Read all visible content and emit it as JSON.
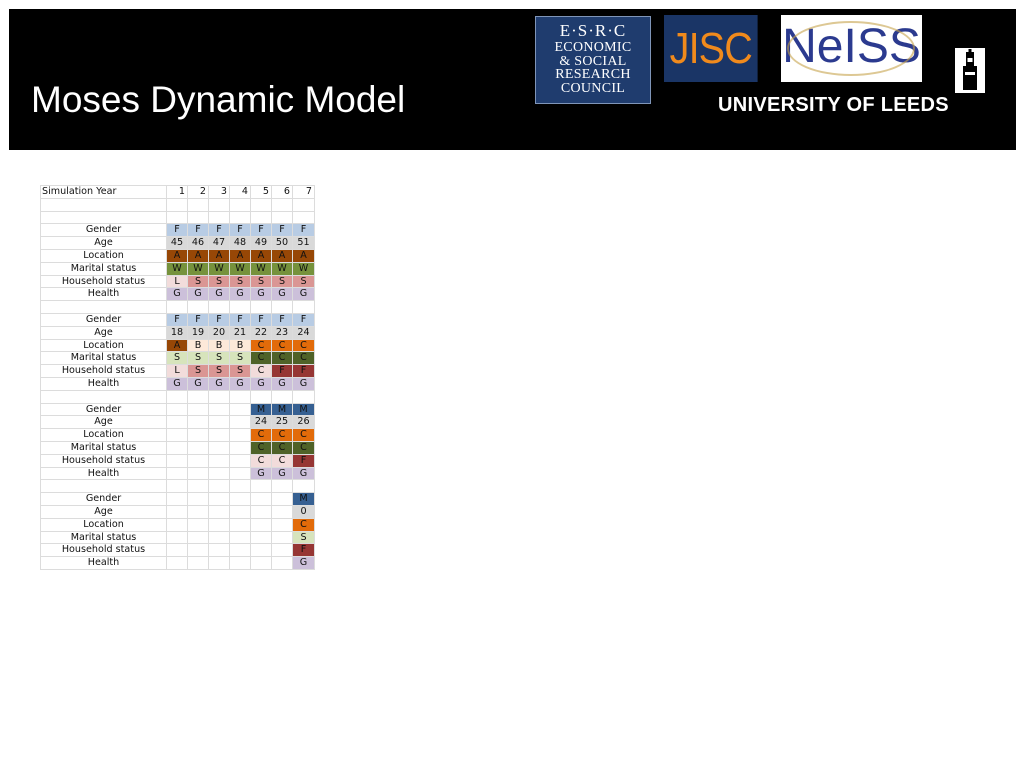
{
  "header": {
    "title": "Moses Dynamic Model",
    "logos": {
      "esrc": [
        "E·S·R·C",
        "ECONOMIC",
        "& SOCIAL",
        "RESEARCH",
        "COUNCIL"
      ],
      "jisc": "JISC",
      "neiss": "NeISS",
      "leeds": "UNIVERSITY OF LEEDS"
    }
  },
  "colors": {
    "gender_f": "#b8cce4",
    "gender_m": "#366092",
    "age": "#d9d9d9",
    "loc_a": "#974706",
    "loc_b": "#fde9d9",
    "loc_c": "#e26b0a",
    "marital_w": "#76923c",
    "marital_s": "#d7e4bc",
    "marital_c": "#4f6228",
    "household_l": "#f2dcdb",
    "household_s": "#da9694",
    "household_c": "#f2dcdb",
    "household_f": "#963634",
    "health_g": "#ccc0da"
  },
  "table": {
    "header_label": "Simulation Year",
    "years": [
      "1",
      "2",
      "3",
      "4",
      "5",
      "6",
      "7"
    ],
    "persons": [
      {
        "rows": [
          {
            "label": "Gender",
            "values": [
              "F",
              "F",
              "F",
              "F",
              "F",
              "F",
              "F"
            ],
            "colors": [
              "gender_f",
              "gender_f",
              "gender_f",
              "gender_f",
              "gender_f",
              "gender_f",
              "gender_f"
            ]
          },
          {
            "label": "Age",
            "values": [
              "45",
              "46",
              "47",
              "48",
              "49",
              "50",
              "51"
            ],
            "colors": [
              "age",
              "age",
              "age",
              "age",
              "age",
              "age",
              "age"
            ]
          },
          {
            "label": "Location",
            "values": [
              "A",
              "A",
              "A",
              "A",
              "A",
              "A",
              "A"
            ],
            "colors": [
              "loc_a",
              "loc_a",
              "loc_a",
              "loc_a",
              "loc_a",
              "loc_a",
              "loc_a"
            ]
          },
          {
            "label": "Marital status",
            "values": [
              "W",
              "W",
              "W",
              "W",
              "W",
              "W",
              "W"
            ],
            "colors": [
              "marital_w",
              "marital_w",
              "marital_w",
              "marital_w",
              "marital_w",
              "marital_w",
              "marital_w"
            ]
          },
          {
            "label": "Household status",
            "values": [
              "L",
              "S",
              "S",
              "S",
              "S",
              "S",
              "S"
            ],
            "colors": [
              "household_l",
              "household_s",
              "household_s",
              "household_s",
              "household_s",
              "household_s",
              "household_s"
            ]
          },
          {
            "label": "Health",
            "values": [
              "G",
              "G",
              "G",
              "G",
              "G",
              "G",
              "G"
            ],
            "colors": [
              "health_g",
              "health_g",
              "health_g",
              "health_g",
              "health_g",
              "health_g",
              "health_g"
            ]
          }
        ]
      },
      {
        "rows": [
          {
            "label": "Gender",
            "values": [
              "F",
              "F",
              "F",
              "F",
              "F",
              "F",
              "F"
            ],
            "colors": [
              "gender_f",
              "gender_f",
              "gender_f",
              "gender_f",
              "gender_f",
              "gender_f",
              "gender_f"
            ]
          },
          {
            "label": "Age",
            "values": [
              "18",
              "19",
              "20",
              "21",
              "22",
              "23",
              "24"
            ],
            "colors": [
              "age",
              "age",
              "age",
              "age",
              "age",
              "age",
              "age"
            ]
          },
          {
            "label": "Location",
            "values": [
              "A",
              "B",
              "B",
              "B",
              "C",
              "C",
              "C"
            ],
            "colors": [
              "loc_a",
              "loc_b",
              "loc_b",
              "loc_b",
              "loc_c",
              "loc_c",
              "loc_c"
            ]
          },
          {
            "label": "Marital status",
            "values": [
              "S",
              "S",
              "S",
              "S",
              "C",
              "C",
              "C"
            ],
            "colors": [
              "marital_s",
              "marital_s",
              "marital_s",
              "marital_s",
              "marital_c",
              "marital_c",
              "marital_c"
            ]
          },
          {
            "label": "Household status",
            "values": [
              "L",
              "S",
              "S",
              "S",
              "C",
              "F",
              "F"
            ],
            "colors": [
              "household_l",
              "household_s",
              "household_s",
              "household_s",
              "household_c",
              "household_f",
              "household_f"
            ]
          },
          {
            "label": "Health",
            "values": [
              "G",
              "G",
              "G",
              "G",
              "G",
              "G",
              "G"
            ],
            "colors": [
              "health_g",
              "health_g",
              "health_g",
              "health_g",
              "health_g",
              "health_g",
              "health_g"
            ]
          }
        ]
      },
      {
        "rows": [
          {
            "label": "Gender",
            "values": [
              "",
              "",
              "",
              "",
              "M",
              "M",
              "M"
            ],
            "colors": [
              "",
              "",
              "",
              "",
              "gender_m",
              "gender_m",
              "gender_m"
            ]
          },
          {
            "label": "Age",
            "values": [
              "",
              "",
              "",
              "",
              "24",
              "25",
              "26"
            ],
            "colors": [
              "",
              "",
              "",
              "",
              "age",
              "age",
              "age"
            ]
          },
          {
            "label": "Location",
            "values": [
              "",
              "",
              "",
              "",
              "C",
              "C",
              "C"
            ],
            "colors": [
              "",
              "",
              "",
              "",
              "loc_c",
              "loc_c",
              "loc_c"
            ]
          },
          {
            "label": "Marital status",
            "values": [
              "",
              "",
              "",
              "",
              "C",
              "C",
              "C"
            ],
            "colors": [
              "",
              "",
              "",
              "",
              "marital_c",
              "marital_c",
              "marital_c"
            ]
          },
          {
            "label": "Household status",
            "values": [
              "",
              "",
              "",
              "",
              "C",
              "C",
              "F"
            ],
            "colors": [
              "",
              "",
              "",
              "",
              "household_c",
              "household_c",
              "household_f"
            ]
          },
          {
            "label": "Health",
            "values": [
              "",
              "",
              "",
              "",
              "G",
              "G",
              "G"
            ],
            "colors": [
              "",
              "",
              "",
              "",
              "health_g",
              "health_g",
              "health_g"
            ]
          }
        ]
      },
      {
        "rows": [
          {
            "label": "Gender",
            "values": [
              "",
              "",
              "",
              "",
              "",
              "",
              "M"
            ],
            "colors": [
              "",
              "",
              "",
              "",
              "",
              "",
              "gender_m"
            ]
          },
          {
            "label": "Age",
            "values": [
              "",
              "",
              "",
              "",
              "",
              "",
              "0"
            ],
            "colors": [
              "",
              "",
              "",
              "",
              "",
              "",
              "age"
            ]
          },
          {
            "label": "Location",
            "values": [
              "",
              "",
              "",
              "",
              "",
              "",
              "C"
            ],
            "colors": [
              "",
              "",
              "",
              "",
              "",
              "",
              "loc_c"
            ]
          },
          {
            "label": "Marital status",
            "values": [
              "",
              "",
              "",
              "",
              "",
              "",
              "S"
            ],
            "colors": [
              "",
              "",
              "",
              "",
              "",
              "",
              "marital_s"
            ]
          },
          {
            "label": "Household status",
            "values": [
              "",
              "",
              "",
              "",
              "",
              "",
              "F"
            ],
            "colors": [
              "",
              "",
              "",
              "",
              "",
              "",
              "household_f"
            ]
          },
          {
            "label": "Health",
            "values": [
              "",
              "",
              "",
              "",
              "",
              "",
              "G"
            ],
            "colors": [
              "",
              "",
              "",
              "",
              "",
              "",
              "health_g"
            ]
          }
        ]
      }
    ]
  }
}
